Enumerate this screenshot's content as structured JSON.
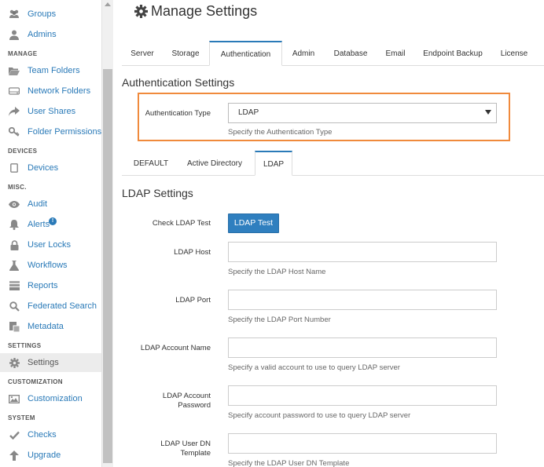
{
  "sidebar": {
    "items": [
      {
        "label": "Groups",
        "icon": "users-icon"
      },
      {
        "label": "Admins",
        "icon": "admin-icon"
      },
      {
        "label": "Team Folders",
        "icon": "folder-open-icon"
      },
      {
        "label": "Network Folders",
        "icon": "hdd-icon"
      },
      {
        "label": "User Shares",
        "icon": "share-icon"
      },
      {
        "label": "Folder Permissions",
        "icon": "key-icon"
      },
      {
        "label": "Devices",
        "icon": "tablet-icon"
      },
      {
        "label": "Audit",
        "icon": "eye-icon"
      },
      {
        "label": "Alerts",
        "icon": "bell-icon",
        "badge": "!"
      },
      {
        "label": "User Locks",
        "icon": "lock-icon"
      },
      {
        "label": "Workflows",
        "icon": "flask-icon"
      },
      {
        "label": "Reports",
        "icon": "chart-icon"
      },
      {
        "label": "Federated Search",
        "icon": "search-icon"
      },
      {
        "label": "Metadata",
        "icon": "metadata-icon"
      },
      {
        "label": "Settings",
        "icon": "gear-icon",
        "active": true
      },
      {
        "label": "Customization",
        "icon": "image-icon"
      },
      {
        "label": "Checks",
        "icon": "check-icon"
      },
      {
        "label": "Upgrade",
        "icon": "arrow-up-icon"
      }
    ],
    "sections": [
      "MANAGE",
      "DEVICES",
      "MISC.",
      "SETTINGS",
      "CUSTOMIZATION",
      "SYSTEM"
    ]
  },
  "page": {
    "title": "Manage Settings",
    "title_icon": "gear-icon"
  },
  "tabs": [
    "Server",
    "Storage",
    "Authentication",
    "Admin",
    "Database",
    "Email",
    "Endpoint Backup",
    "License"
  ],
  "active_tab": "Authentication",
  "auth": {
    "section_title": "Authentication Settings",
    "type_label": "Authentication Type",
    "type_value": "LDAP",
    "type_help": "Specify the Authentication Type"
  },
  "subtabs": [
    "DEFAULT",
    "Active Directory",
    "LDAP"
  ],
  "active_subtab": "LDAP",
  "ldap": {
    "section_title": "LDAP Settings",
    "test_label": "Check LDAP Test",
    "test_button": "LDAP Test",
    "fields": [
      {
        "label": "LDAP Host",
        "value": "",
        "help": "Specify the LDAP Host Name"
      },
      {
        "label": "LDAP Port",
        "value": "",
        "help": "Specify the LDAP Port Number"
      },
      {
        "label": "LDAP Account Name",
        "value": "",
        "help": "Specify a valid account to use to query LDAP server"
      },
      {
        "label": "LDAP Account Password",
        "value": "",
        "help": "Specify account password to use to query LDAP server"
      },
      {
        "label": "LDAP User DN Template",
        "value": "",
        "help": "Specify the LDAP User DN Template"
      }
    ]
  },
  "colors": {
    "link": "#2a7ab8",
    "highlight": "#f08a3c",
    "button": "#2f7fbf"
  }
}
